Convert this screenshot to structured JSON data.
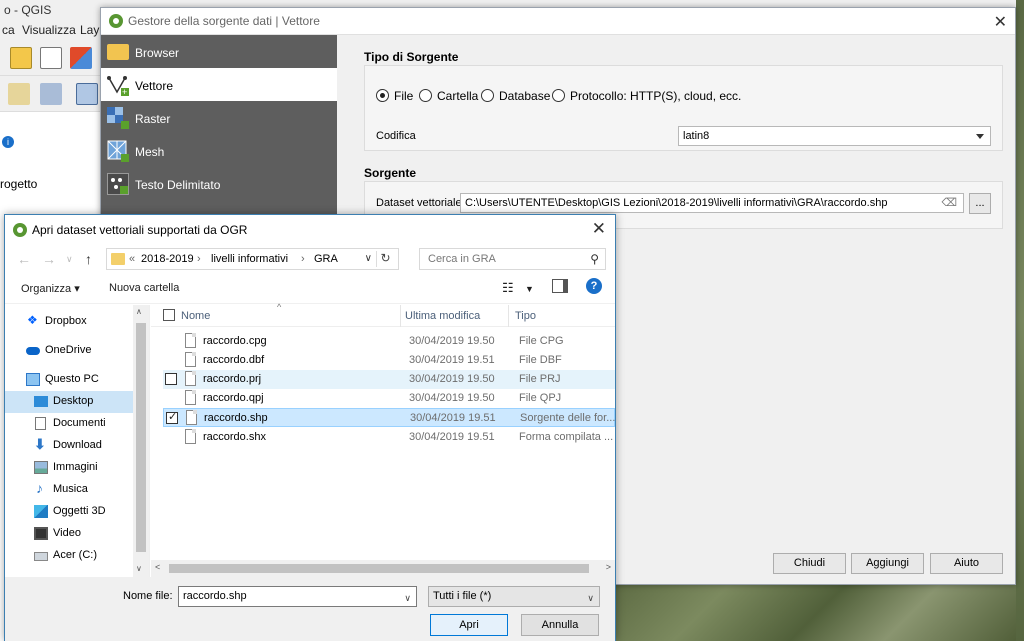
{
  "qgis": {
    "title": "o - QGIS",
    "menus": [
      "ca",
      "Visualizza",
      "Lay"
    ],
    "panel_text": "rogetto"
  },
  "dsm": {
    "title": "Gestore della sorgente dati | Vettore",
    "sidebar": [
      {
        "label": "Browser",
        "icon": "folder-icon"
      },
      {
        "label": "Vettore",
        "icon": "vector-layer-icon"
      },
      {
        "label": "Raster",
        "icon": "raster-layer-icon"
      },
      {
        "label": "Mesh",
        "icon": "mesh-layer-icon"
      },
      {
        "label": "Testo Delimitato",
        "icon": "delimited-text-icon"
      }
    ],
    "source_type_title": "Tipo di Sorgente",
    "radios": [
      "File",
      "Cartella",
      "Database",
      "Protocollo: HTTP(S), cloud, ecc."
    ],
    "encoding_label": "Codifica",
    "encoding_value": "latin8",
    "source_title": "Sorgente",
    "dataset_label": "Dataset vettoriale",
    "dataset_path": "C:\\Users\\UTENTE\\Desktop\\GIS Lezioni\\2018-2019\\livelli informativi\\GRA\\raccordo.shp",
    "browse_label": "...",
    "buttons": {
      "close": "Chiudi",
      "add": "Aggiungi",
      "help": "Aiuto"
    }
  },
  "fd": {
    "title": "Apri dataset vettoriali supportati da OGR",
    "breadcrumb": [
      "2018-2019",
      "livelli informativi",
      "GRA"
    ],
    "breadcrumb_prefix": "«",
    "search_placeholder": "Cerca in GRA",
    "organize": "Organizza",
    "new_folder": "Nuova cartella",
    "nav": [
      {
        "label": "Dropbox",
        "icon": "dropbox-icon"
      },
      {
        "label": "OneDrive",
        "icon": "onedrive-icon"
      },
      {
        "label": "Questo PC",
        "icon": "computer-icon"
      },
      {
        "label": "Desktop",
        "icon": "desktop-icon"
      },
      {
        "label": "Documenti",
        "icon": "documents-icon"
      },
      {
        "label": "Download",
        "icon": "download-icon"
      },
      {
        "label": "Immagini",
        "icon": "pictures-icon"
      },
      {
        "label": "Musica",
        "icon": "music-icon"
      },
      {
        "label": "Oggetti 3D",
        "icon": "3d-objects-icon"
      },
      {
        "label": "Video",
        "icon": "video-icon"
      },
      {
        "label": "Acer (C:)",
        "icon": "drive-icon"
      }
    ],
    "columns": {
      "name": "Nome",
      "modified": "Ultima modifica",
      "type": "Tipo"
    },
    "files": [
      {
        "name": "raccordo.cpg",
        "modified": "30/04/2019 19.50",
        "type": "File CPG"
      },
      {
        "name": "raccordo.dbf",
        "modified": "30/04/2019 19.51",
        "type": "File DBF"
      },
      {
        "name": "raccordo.prj",
        "modified": "30/04/2019 19.50",
        "type": "File PRJ"
      },
      {
        "name": "raccordo.qpj",
        "modified": "30/04/2019 19.50",
        "type": "File QPJ"
      },
      {
        "name": "raccordo.shp",
        "modified": "30/04/2019 19.51",
        "type": "Sorgente delle for..."
      },
      {
        "name": "raccordo.shx",
        "modified": "30/04/2019 19.51",
        "type": "Forma compilata ..."
      }
    ],
    "filename_label": "Nome file:",
    "filename_value": "raccordo.shp",
    "filetype_value": "Tutti i file  (*)",
    "open": "Apri",
    "cancel": "Annulla"
  },
  "colors": {
    "qgis_green": "#589632",
    "sidebar_bg": "#5e5e5e",
    "selection": "#cce8ff",
    "help_blue": "#1a6fc9"
  }
}
